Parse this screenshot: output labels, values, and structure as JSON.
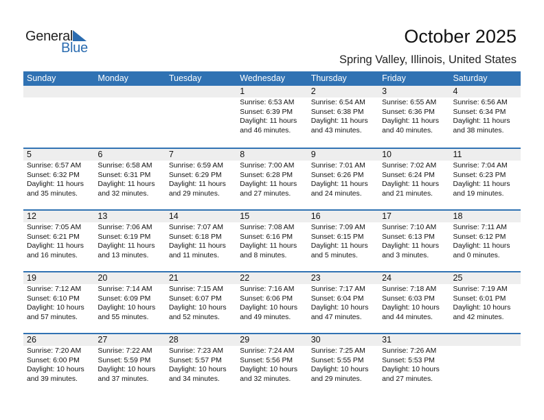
{
  "logo": {
    "general": "General",
    "blue": "Blue",
    "accent": "#2b6cb0"
  },
  "header": {
    "title": "October 2025",
    "location": "Spring Valley, Illinois, United States"
  },
  "colors": {
    "header_bg": "#3072b3",
    "number_row_bg": "#eeeeee"
  },
  "days": [
    "Sunday",
    "Monday",
    "Tuesday",
    "Wednesday",
    "Thursday",
    "Friday",
    "Saturday"
  ],
  "weeks": [
    [
      {
        "day": "",
        "sunrise": "",
        "sunset": "",
        "daylight": "",
        "minutes": ""
      },
      {
        "day": "",
        "sunrise": "",
        "sunset": "",
        "daylight": "",
        "minutes": ""
      },
      {
        "day": "",
        "sunrise": "",
        "sunset": "",
        "daylight": "",
        "minutes": ""
      },
      {
        "day": "1",
        "sunrise": "Sunrise: 6:53 AM",
        "sunset": "Sunset: 6:39 PM",
        "daylight": "Daylight: 11 hours",
        "minutes": "and 46 minutes."
      },
      {
        "day": "2",
        "sunrise": "Sunrise: 6:54 AM",
        "sunset": "Sunset: 6:38 PM",
        "daylight": "Daylight: 11 hours",
        "minutes": "and 43 minutes."
      },
      {
        "day": "3",
        "sunrise": "Sunrise: 6:55 AM",
        "sunset": "Sunset: 6:36 PM",
        "daylight": "Daylight: 11 hours",
        "minutes": "and 40 minutes."
      },
      {
        "day": "4",
        "sunrise": "Sunrise: 6:56 AM",
        "sunset": "Sunset: 6:34 PM",
        "daylight": "Daylight: 11 hours",
        "minutes": "and 38 minutes."
      }
    ],
    [
      {
        "day": "5",
        "sunrise": "Sunrise: 6:57 AM",
        "sunset": "Sunset: 6:32 PM",
        "daylight": "Daylight: 11 hours",
        "minutes": "and 35 minutes."
      },
      {
        "day": "6",
        "sunrise": "Sunrise: 6:58 AM",
        "sunset": "Sunset: 6:31 PM",
        "daylight": "Daylight: 11 hours",
        "minutes": "and 32 minutes."
      },
      {
        "day": "7",
        "sunrise": "Sunrise: 6:59 AM",
        "sunset": "Sunset: 6:29 PM",
        "daylight": "Daylight: 11 hours",
        "minutes": "and 29 minutes."
      },
      {
        "day": "8",
        "sunrise": "Sunrise: 7:00 AM",
        "sunset": "Sunset: 6:28 PM",
        "daylight": "Daylight: 11 hours",
        "minutes": "and 27 minutes."
      },
      {
        "day": "9",
        "sunrise": "Sunrise: 7:01 AM",
        "sunset": "Sunset: 6:26 PM",
        "daylight": "Daylight: 11 hours",
        "minutes": "and 24 minutes."
      },
      {
        "day": "10",
        "sunrise": "Sunrise: 7:02 AM",
        "sunset": "Sunset: 6:24 PM",
        "daylight": "Daylight: 11 hours",
        "minutes": "and 21 minutes."
      },
      {
        "day": "11",
        "sunrise": "Sunrise: 7:04 AM",
        "sunset": "Sunset: 6:23 PM",
        "daylight": "Daylight: 11 hours",
        "minutes": "and 19 minutes."
      }
    ],
    [
      {
        "day": "12",
        "sunrise": "Sunrise: 7:05 AM",
        "sunset": "Sunset: 6:21 PM",
        "daylight": "Daylight: 11 hours",
        "minutes": "and 16 minutes."
      },
      {
        "day": "13",
        "sunrise": "Sunrise: 7:06 AM",
        "sunset": "Sunset: 6:19 PM",
        "daylight": "Daylight: 11 hours",
        "minutes": "and 13 minutes."
      },
      {
        "day": "14",
        "sunrise": "Sunrise: 7:07 AM",
        "sunset": "Sunset: 6:18 PM",
        "daylight": "Daylight: 11 hours",
        "minutes": "and 11 minutes."
      },
      {
        "day": "15",
        "sunrise": "Sunrise: 7:08 AM",
        "sunset": "Sunset: 6:16 PM",
        "daylight": "Daylight: 11 hours",
        "minutes": "and 8 minutes."
      },
      {
        "day": "16",
        "sunrise": "Sunrise: 7:09 AM",
        "sunset": "Sunset: 6:15 PM",
        "daylight": "Daylight: 11 hours",
        "minutes": "and 5 minutes."
      },
      {
        "day": "17",
        "sunrise": "Sunrise: 7:10 AM",
        "sunset": "Sunset: 6:13 PM",
        "daylight": "Daylight: 11 hours",
        "minutes": "and 3 minutes."
      },
      {
        "day": "18",
        "sunrise": "Sunrise: 7:11 AM",
        "sunset": "Sunset: 6:12 PM",
        "daylight": "Daylight: 11 hours",
        "minutes": "and 0 minutes."
      }
    ],
    [
      {
        "day": "19",
        "sunrise": "Sunrise: 7:12 AM",
        "sunset": "Sunset: 6:10 PM",
        "daylight": "Daylight: 10 hours",
        "minutes": "and 57 minutes."
      },
      {
        "day": "20",
        "sunrise": "Sunrise: 7:14 AM",
        "sunset": "Sunset: 6:09 PM",
        "daylight": "Daylight: 10 hours",
        "minutes": "and 55 minutes."
      },
      {
        "day": "21",
        "sunrise": "Sunrise: 7:15 AM",
        "sunset": "Sunset: 6:07 PM",
        "daylight": "Daylight: 10 hours",
        "minutes": "and 52 minutes."
      },
      {
        "day": "22",
        "sunrise": "Sunrise: 7:16 AM",
        "sunset": "Sunset: 6:06 PM",
        "daylight": "Daylight: 10 hours",
        "minutes": "and 49 minutes."
      },
      {
        "day": "23",
        "sunrise": "Sunrise: 7:17 AM",
        "sunset": "Sunset: 6:04 PM",
        "daylight": "Daylight: 10 hours",
        "minutes": "and 47 minutes."
      },
      {
        "day": "24",
        "sunrise": "Sunrise: 7:18 AM",
        "sunset": "Sunset: 6:03 PM",
        "daylight": "Daylight: 10 hours",
        "minutes": "and 44 minutes."
      },
      {
        "day": "25",
        "sunrise": "Sunrise: 7:19 AM",
        "sunset": "Sunset: 6:01 PM",
        "daylight": "Daylight: 10 hours",
        "minutes": "and 42 minutes."
      }
    ],
    [
      {
        "day": "26",
        "sunrise": "Sunrise: 7:20 AM",
        "sunset": "Sunset: 6:00 PM",
        "daylight": "Daylight: 10 hours",
        "minutes": "and 39 minutes."
      },
      {
        "day": "27",
        "sunrise": "Sunrise: 7:22 AM",
        "sunset": "Sunset: 5:59 PM",
        "daylight": "Daylight: 10 hours",
        "minutes": "and 37 minutes."
      },
      {
        "day": "28",
        "sunrise": "Sunrise: 7:23 AM",
        "sunset": "Sunset: 5:57 PM",
        "daylight": "Daylight: 10 hours",
        "minutes": "and 34 minutes."
      },
      {
        "day": "29",
        "sunrise": "Sunrise: 7:24 AM",
        "sunset": "Sunset: 5:56 PM",
        "daylight": "Daylight: 10 hours",
        "minutes": "and 32 minutes."
      },
      {
        "day": "30",
        "sunrise": "Sunrise: 7:25 AM",
        "sunset": "Sunset: 5:55 PM",
        "daylight": "Daylight: 10 hours",
        "minutes": "and 29 minutes."
      },
      {
        "day": "31",
        "sunrise": "Sunrise: 7:26 AM",
        "sunset": "Sunset: 5:53 PM",
        "daylight": "Daylight: 10 hours",
        "minutes": "and 27 minutes."
      },
      {
        "day": "",
        "sunrise": "",
        "sunset": "",
        "daylight": "",
        "minutes": ""
      }
    ]
  ]
}
